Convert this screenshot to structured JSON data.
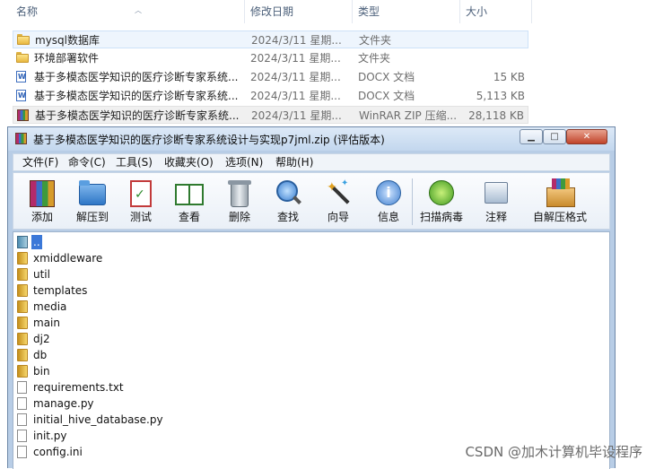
{
  "explorer": {
    "columns": {
      "name": "名称",
      "date": "修改日期",
      "type": "类型",
      "size": "大小"
    },
    "rows": [
      {
        "icon": "folder-icon",
        "name": "mysql数据库",
        "date": "2024/3/11 星期...",
        "type": "文件夹",
        "size": "",
        "state": "selected"
      },
      {
        "icon": "folder-icon",
        "name": "环境部署软件",
        "date": "2024/3/11 星期...",
        "type": "文件夹",
        "size": "",
        "state": ""
      },
      {
        "icon": "docx-icon",
        "name": "基于多模态医学知识的医疗诊断专家系统...",
        "date": "2024/3/11 星期...",
        "type": "DOCX 文档",
        "size": "15 KB",
        "state": ""
      },
      {
        "icon": "docx-icon",
        "name": "基于多模态医学知识的医疗诊断专家系统...",
        "date": "2024/3/11 星期...",
        "type": "DOCX 文档",
        "size": "5,113 KB",
        "state": ""
      },
      {
        "icon": "winrar-icon",
        "name": "基于多模态医学知识的医疗诊断专家系统...",
        "date": "2024/3/11 星期...",
        "type": "WinRAR ZIP 压缩...",
        "size": "28,118 KB",
        "state": "hover"
      }
    ]
  },
  "winrar": {
    "title": "基于多模态医学知识的医疗诊断专家系统设计与实现p7jml.zip (评估版本)",
    "window_buttons": {
      "minimize": "▁",
      "maximize": "□",
      "close": "✕"
    },
    "menu": [
      "文件(F)",
      "命令(C)",
      "工具(S)",
      "收藏夹(O)",
      "选项(N)",
      "帮助(H)"
    ],
    "toolbar": [
      {
        "label": "添加",
        "icon": "add-archive-icon"
      },
      {
        "label": "解压到",
        "icon": "extract-to-icon"
      },
      {
        "label": "测试",
        "icon": "test-icon"
      },
      {
        "label": "查看",
        "icon": "view-book-icon"
      },
      {
        "label": "删除",
        "icon": "trash-icon"
      },
      {
        "label": "查找",
        "icon": "find-magnifier-icon"
      },
      {
        "label": "向导",
        "icon": "wizard-wand-icon"
      },
      {
        "label": "信息",
        "icon": "info-icon"
      },
      {
        "label": "扫描病毒",
        "icon": "virus-scan-icon"
      },
      {
        "label": "注释",
        "icon": "comment-icon"
      },
      {
        "label": "自解压格式",
        "icon": "sfx-box-icon"
      }
    ],
    "files": [
      {
        "name": "..",
        "kind": "up"
      },
      {
        "name": "xmiddleware",
        "kind": "folder"
      },
      {
        "name": "util",
        "kind": "folder"
      },
      {
        "name": "templates",
        "kind": "folder"
      },
      {
        "name": "media",
        "kind": "folder"
      },
      {
        "name": "main",
        "kind": "folder"
      },
      {
        "name": "dj2",
        "kind": "folder"
      },
      {
        "name": "db",
        "kind": "folder"
      },
      {
        "name": "bin",
        "kind": "folder"
      },
      {
        "name": "requirements.txt",
        "kind": "file"
      },
      {
        "name": "manage.py",
        "kind": "file"
      },
      {
        "name": "initial_hive_database.py",
        "kind": "file"
      },
      {
        "name": "init.py",
        "kind": "file"
      },
      {
        "name": "config.ini",
        "kind": "file"
      }
    ]
  },
  "watermark": "CSDN @加木计算机毕设程序"
}
